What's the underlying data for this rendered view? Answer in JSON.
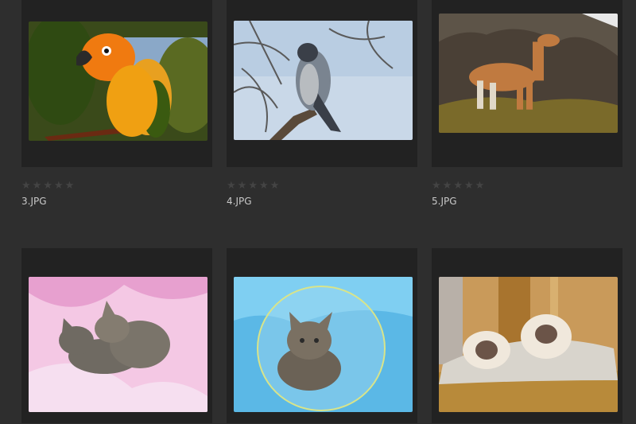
{
  "gallery": {
    "items": [
      {
        "filename": "3.JPG",
        "rating": 0,
        "rating_max": 5,
        "subject": "parrot"
      },
      {
        "filename": "4.JPG",
        "rating": 0,
        "rating_max": 5,
        "subject": "falcon"
      },
      {
        "filename": "5.JPG",
        "rating": 0,
        "rating_max": 5,
        "subject": "llama"
      },
      {
        "subject": "kittens-pink"
      },
      {
        "subject": "kitten-bubble"
      },
      {
        "subject": "kittens-basket"
      }
    ]
  },
  "colors": {
    "background": "#2e2e2e",
    "card": "#222222",
    "star_empty": "#444444",
    "filename_text": "#c8c8c8"
  }
}
